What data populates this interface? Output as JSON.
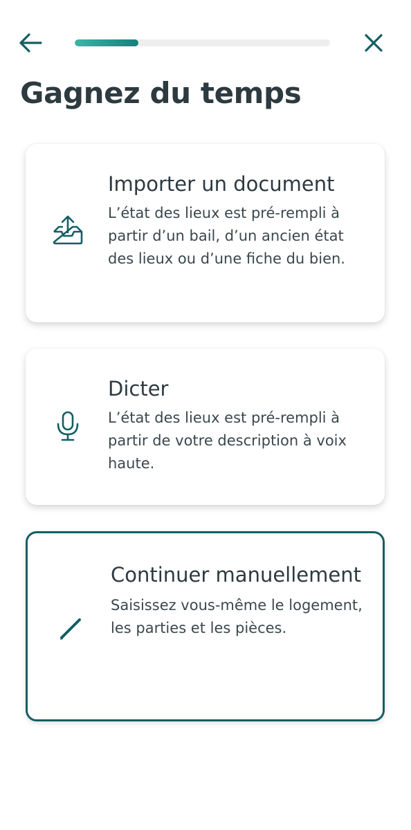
{
  "header": {
    "progress_fraction": 0.25,
    "back_icon": "arrow-left-icon",
    "close_icon": "close-icon"
  },
  "page": {
    "title": "Gagnez du temps"
  },
  "options": [
    {
      "title": "Importer un document",
      "description": "L’état des lieux est pré-rempli à partir d’un bail, d’un ancien état des lieux ou d’une fiche du bien.",
      "icon": "inbox-upload-icon",
      "selected": false
    },
    {
      "title": "Dicter",
      "description": "L’état des lieux est pré-rempli à partir de votre description à voix haute.",
      "icon": "microphone-icon",
      "selected": false
    },
    {
      "title": "Continuer manuellement",
      "description": "Saisissez vous-même le logement, les parties et les pièces.",
      "icon": "pencil-icon",
      "selected": true
    }
  ],
  "colors": {
    "accent": "#135e63",
    "progress_start": "#3fb3a6",
    "progress_end": "#17807c",
    "text": "#2d3a40",
    "track": "#eeeeee"
  }
}
